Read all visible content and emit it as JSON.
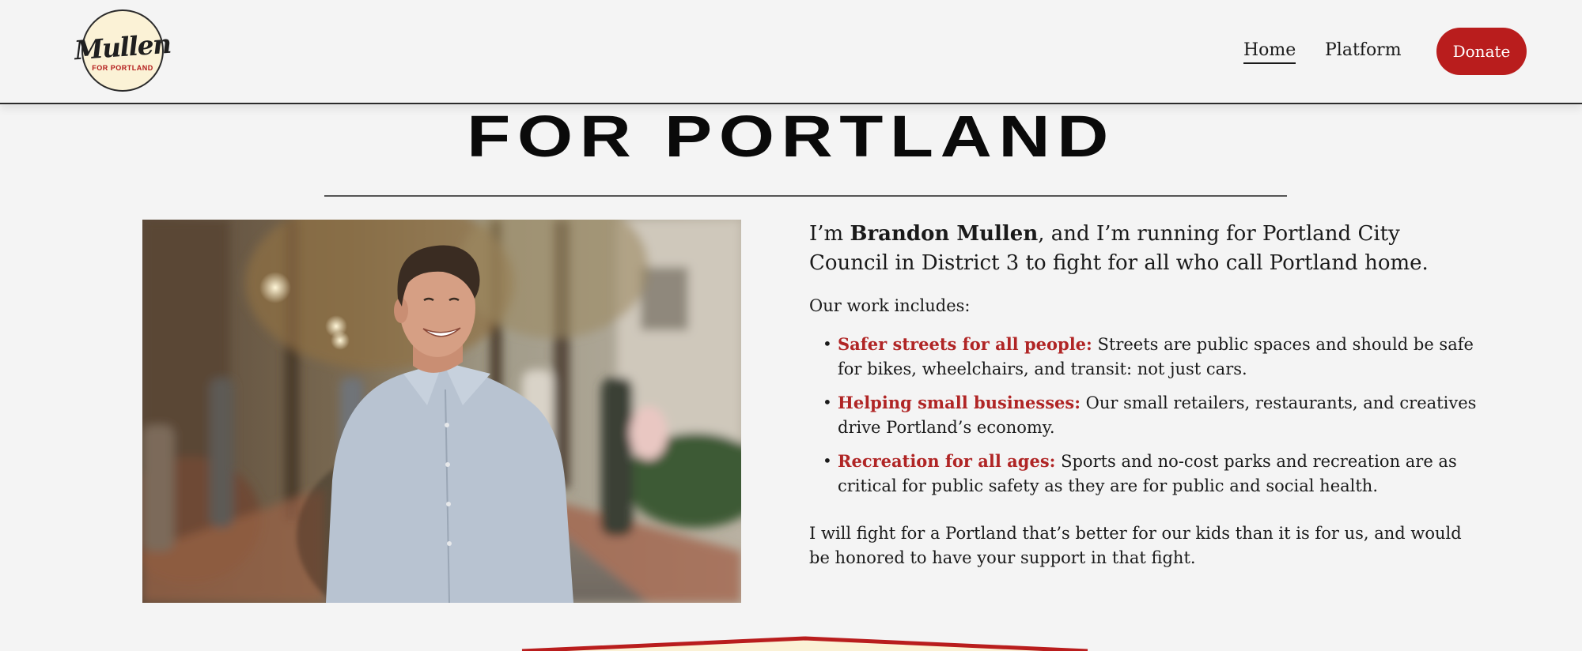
{
  "header": {
    "logo": {
      "name": "Mullen",
      "tagline": "FOR PORTLAND"
    },
    "nav": [
      {
        "label": "Home",
        "active": true
      },
      {
        "label": "Platform",
        "active": false
      }
    ],
    "donate_label": "Donate"
  },
  "hero": {
    "title": "FOR PORTLAND"
  },
  "bio": {
    "intro_prefix": "I’m ",
    "intro_name": "Brandon Mullen",
    "intro_suffix": ", and I’m running for Portland City Council in District 3 to fight for all who call Portland home.",
    "work_heading": "Our work includes:",
    "items": [
      {
        "title": "Safer streets for all people:",
        "text": " Streets are public spaces and should be safe for bikes, wheelchairs, and transit: not just cars."
      },
      {
        "title": "Helping small businesses:",
        "text": " Our small retailers, restaurants, and creatives drive Portland’s economy."
      },
      {
        "title": "Recreation for all ages:",
        "text": " Sports and no-cost parks and recreation are as critical for public safety as they are for public and social health."
      }
    ],
    "closing": "I will fight for a Portland that’s better for our kids than it is for us, and would be honored to have your support in that fight."
  },
  "colors": {
    "accent": "#b91d1d",
    "highlight_text": "#b02525",
    "background": "#f4f4f4",
    "logo_fill": "#fbf2d6"
  }
}
